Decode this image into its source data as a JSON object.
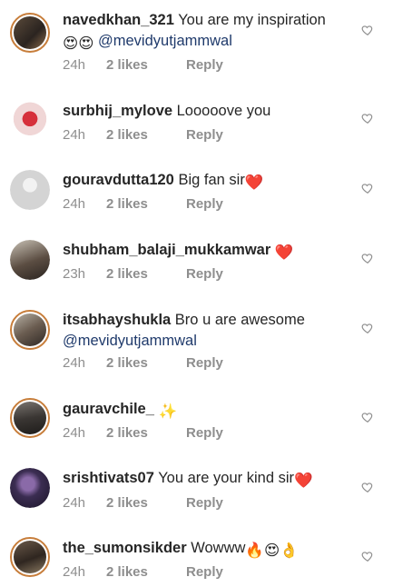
{
  "comments": [
    {
      "username": "navedkhan_321",
      "text": " You are my inspiration",
      "emoji": "😍😍",
      "mention": "@mevidyutjammwal",
      "time": "24h",
      "likes": "2 likes",
      "reply": "Reply"
    },
    {
      "username": "surbhij_mylove",
      "text": " Looooove you",
      "time": "24h",
      "likes": "2 likes",
      "reply": "Reply"
    },
    {
      "username": "gouravdutta120",
      "text": " Big fan sir",
      "emoji": "❤️",
      "time": "24h",
      "likes": "2 likes",
      "reply": "Reply"
    },
    {
      "username": "shubham_balaji_mukkamwar",
      "text": " ",
      "emoji": "❤️",
      "time": "23h",
      "likes": "2 likes",
      "reply": "Reply"
    },
    {
      "username": "itsabhayshukla",
      "text": " Bro u are awesome",
      "mention": "@mevidyutjammwal",
      "time": "24h",
      "likes": "2 likes",
      "reply": "Reply"
    },
    {
      "username": "gauravchile_",
      "text": " ",
      "emoji": "✨",
      "time": "24h",
      "likes": "2 likes",
      "reply": "Reply"
    },
    {
      "username": "srishtivats07",
      "text": " You are your kind sir",
      "emoji": "❤️",
      "time": "24h",
      "likes": "2 likes",
      "reply": "Reply"
    },
    {
      "username": "the_sumonsikder",
      "text": " Wowww",
      "emoji": "🔥😍👌",
      "time": "24h",
      "likes": "2 likes",
      "reply": "Reply"
    }
  ],
  "icons": {
    "like": "heart-outline-icon",
    "avatar": "avatar"
  },
  "colors": {
    "meta": "#8e8e8e",
    "mention": "#1f3a6b",
    "heart": "#e0245e",
    "story_ring": "#c77d3a"
  }
}
